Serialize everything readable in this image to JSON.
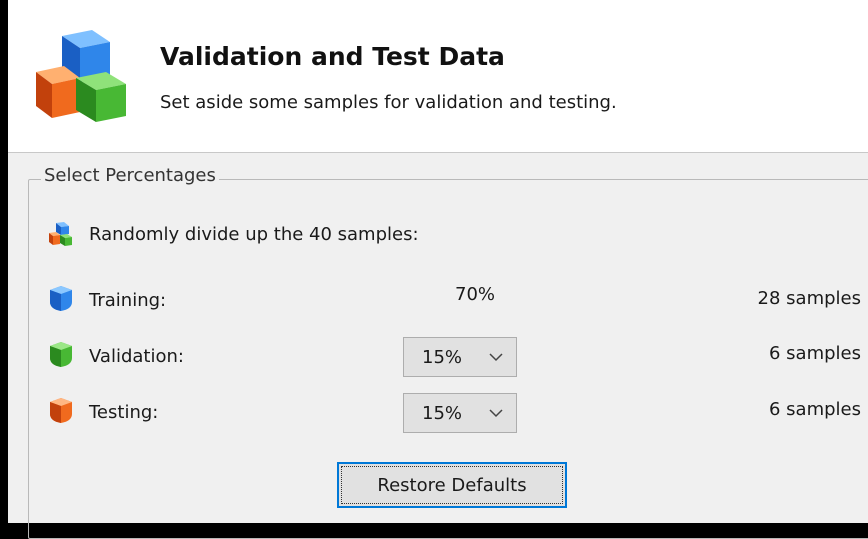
{
  "header": {
    "title": "Validation and Test Data",
    "subtitle": "Set aside some samples for validation and testing.",
    "logo_icon": "cubes-icon"
  },
  "group": {
    "legend": "Select Percentages",
    "intro": "Randomly divide up the 40 samples:",
    "rows": [
      {
        "label": "Training:",
        "percent": "70%",
        "samples": "28 samples",
        "icon": "blue-cube-icon",
        "color": "#1e78d8"
      },
      {
        "label": "Validation:",
        "percent": "15%",
        "samples": "6 samples",
        "icon": "green-cube-icon",
        "color": "#3aa52a"
      },
      {
        "label": "Testing:",
        "percent": "15%",
        "samples": "6 samples",
        "icon": "orange-cube-icon",
        "color": "#e0621a"
      }
    ],
    "restore_label": "Restore Defaults"
  },
  "colors": {
    "accent_focus": "#0078d7",
    "panel_bg": "#f0f0f0"
  }
}
